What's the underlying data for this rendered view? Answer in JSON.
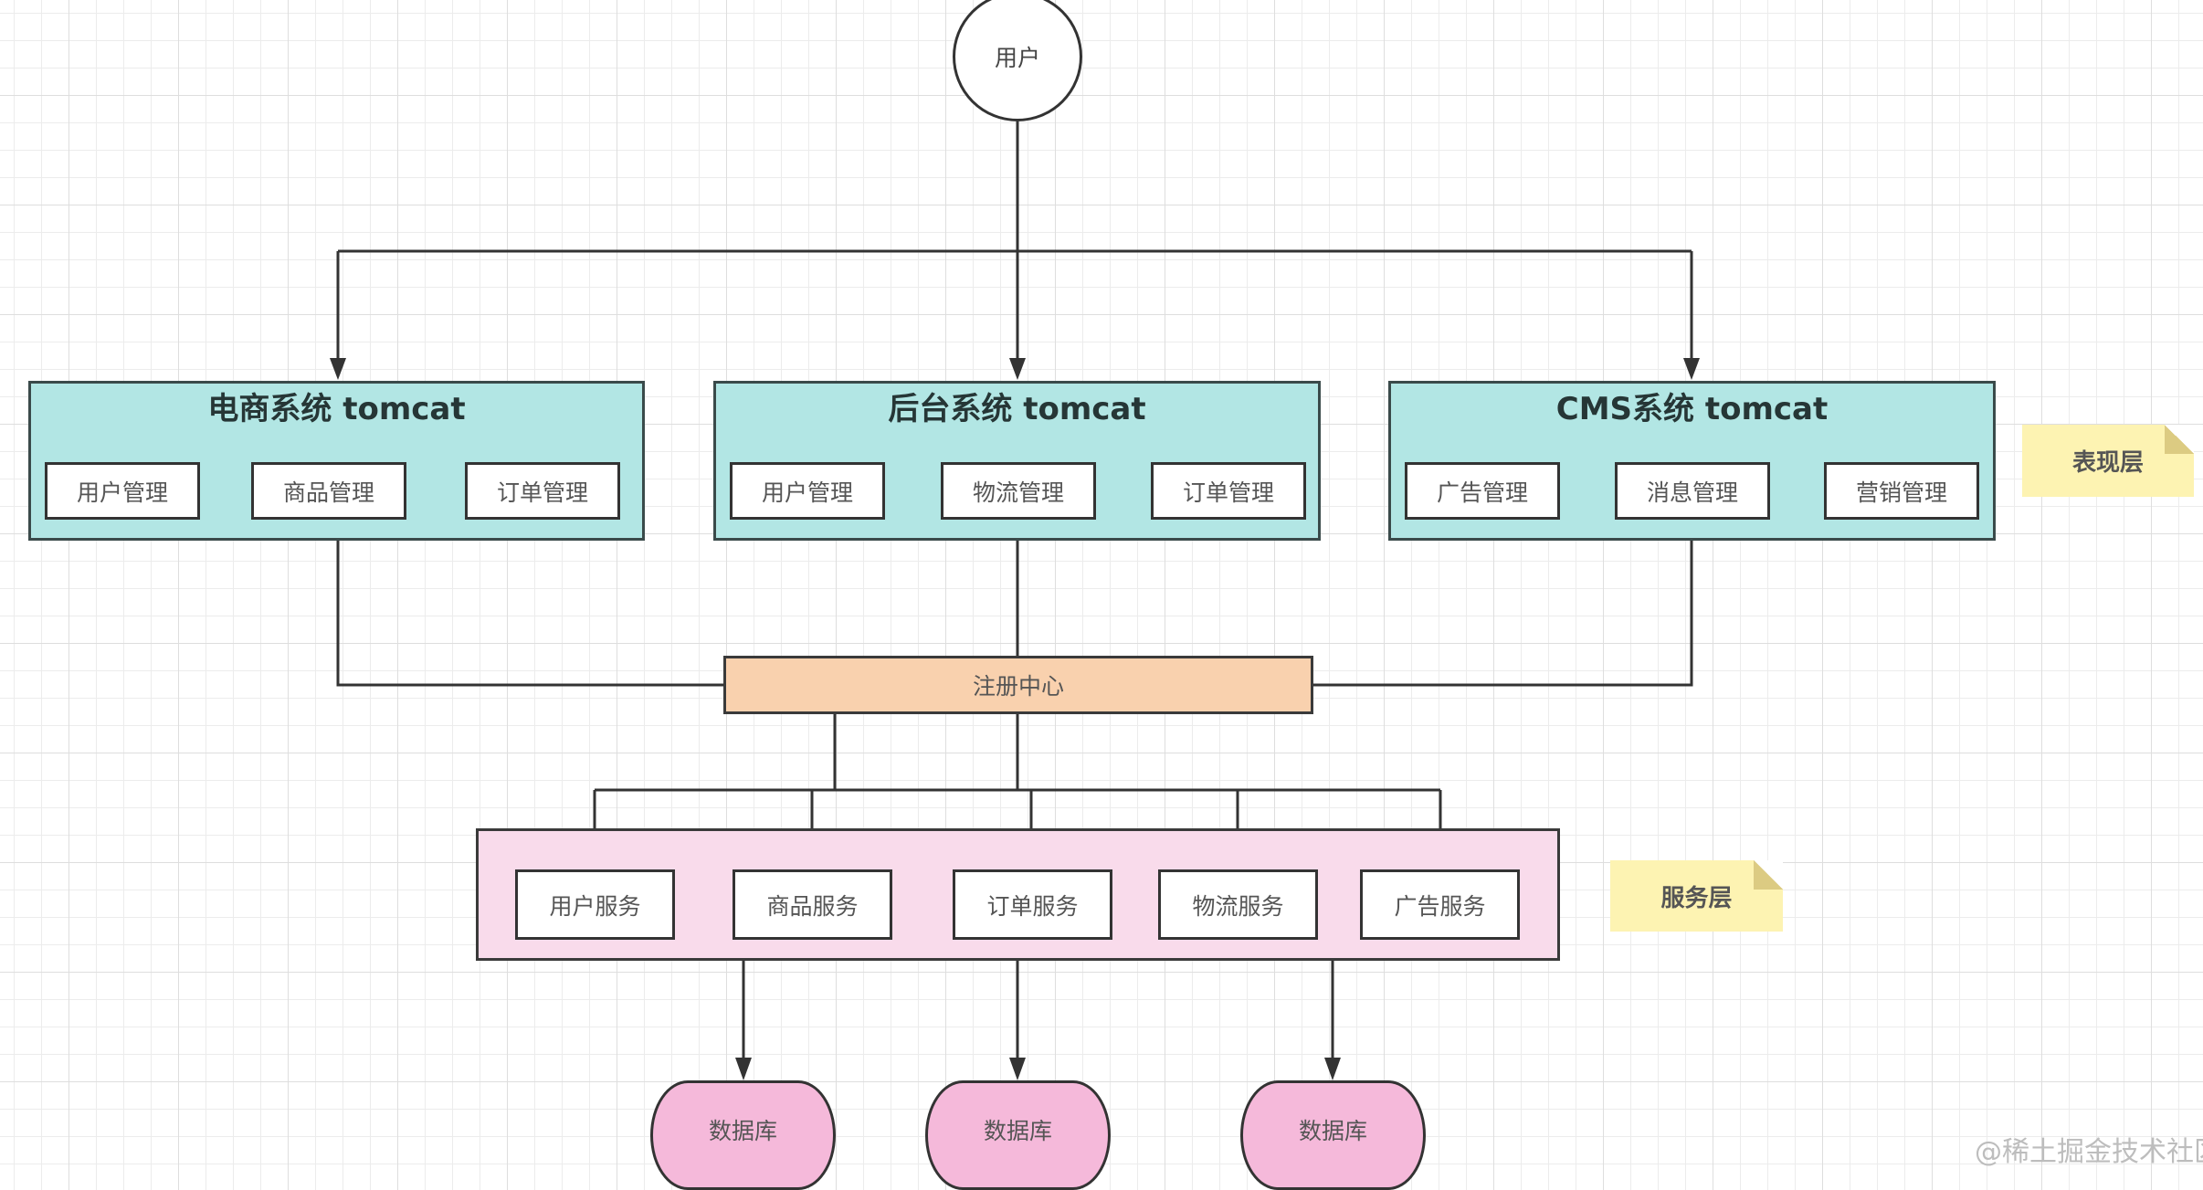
{
  "diagram": {
    "user": {
      "label": "用户"
    },
    "presentation_layer": {
      "note": "表现层",
      "systems": [
        {
          "title": "电商系统 tomcat",
          "modules": [
            "用户管理",
            "商品管理",
            "订单管理"
          ]
        },
        {
          "title": "后台系统 tomcat",
          "modules": [
            "用户管理",
            "物流管理",
            "订单管理"
          ]
        },
        {
          "title": "CMS系统 tomcat",
          "modules": [
            "广告管理",
            "消息管理",
            "营销管理"
          ]
        }
      ]
    },
    "registry": {
      "label": "注册中心"
    },
    "service_layer": {
      "note": "服务层",
      "services": [
        "用户服务",
        "商品服务",
        "订单服务",
        "物流服务",
        "广告服务"
      ]
    },
    "databases": [
      "数据库",
      "数据库",
      "数据库"
    ],
    "watermark": "@稀土掘金技术社区",
    "colors": {
      "system_fill": "#b2e6e4",
      "registry_fill": "#f9d1ae",
      "service_layer_fill": "#f9dbeb",
      "database_fill": "#f5b9da",
      "note_fill": "#fdf3b2",
      "line": "#333333"
    }
  }
}
